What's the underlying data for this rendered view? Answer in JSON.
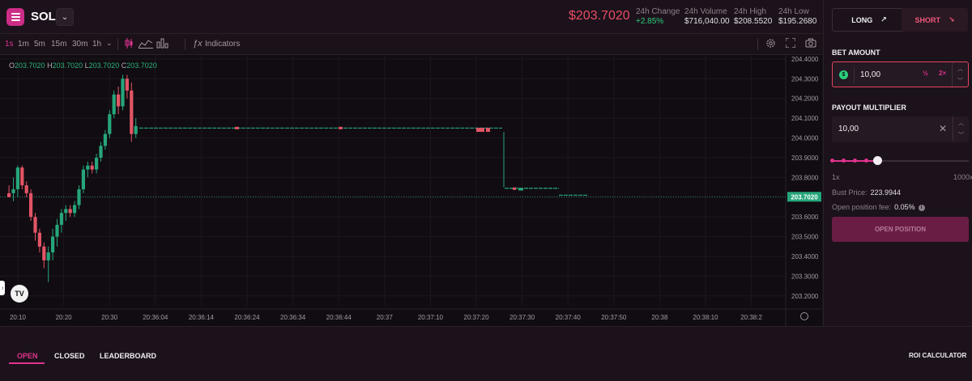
{
  "header": {
    "pair": "SOL",
    "price": "$203.7020",
    "stats": [
      {
        "label": "24h Change",
        "value": "+2.85%",
        "positive": true
      },
      {
        "label": "24h Volume",
        "value": "$716,040.00"
      },
      {
        "label": "24h High",
        "value": "$208.5520"
      },
      {
        "label": "24h Low",
        "value": "$195.2680"
      }
    ]
  },
  "toolbar": {
    "timeframes": [
      "1s",
      "1m",
      "5m",
      "15m",
      "30m",
      "1h"
    ],
    "active_timeframe": "1s",
    "indicators_label": "Indicators"
  },
  "ohlc": {
    "o_label": "O",
    "o": "203.7020",
    "h_label": "H",
    "h": "203.7020",
    "l_label": "L",
    "l": "203.7020",
    "c_label": "C",
    "c": "203.7020"
  },
  "tv_label": "TV",
  "chart_data": {
    "type": "candlestick",
    "ylim": [
      203.15,
      204.42
    ],
    "y_ticks": [
      "204.4000",
      "204.3000",
      "204.2000",
      "204.1000",
      "204.0000",
      "203.9000",
      "203.8000",
      "203.7000",
      "203.6000",
      "203.5000",
      "203.4000",
      "203.3000",
      "203.2000"
    ],
    "x_ticks": [
      "20:10",
      "20:20",
      "20:30",
      "20:36:04",
      "20:36:14",
      "20:36:24",
      "20:36:34",
      "20:36:44",
      "20:37",
      "20:37:10",
      "20:37:20",
      "20:37:30",
      "20:37:40",
      "20:37:50",
      "20:38",
      "20:38:10",
      "20:38:2"
    ],
    "current_price": "203.7020",
    "current_price_value": 203.702,
    "colors": {
      "up": "#26a67a",
      "down": "#e25565",
      "grid": "#1d171e",
      "price_tag": "#26a67a"
    },
    "candles": [
      {
        "o": 203.72,
        "h": 203.76,
        "l": 203.7,
        "c": 203.7
      },
      {
        "o": 203.72,
        "h": 203.8,
        "l": 203.68,
        "c": 203.74
      },
      {
        "o": 203.74,
        "h": 203.86,
        "l": 203.7,
        "c": 203.85
      },
      {
        "o": 203.85,
        "h": 203.86,
        "l": 203.74,
        "c": 203.76
      },
      {
        "o": 203.76,
        "h": 203.78,
        "l": 203.7,
        "c": 203.72
      },
      {
        "o": 203.72,
        "h": 203.74,
        "l": 203.58,
        "c": 203.6
      },
      {
        "o": 203.6,
        "h": 203.62,
        "l": 203.48,
        "c": 203.52
      },
      {
        "o": 203.52,
        "h": 203.54,
        "l": 203.42,
        "c": 203.45
      },
      {
        "o": 203.45,
        "h": 203.47,
        "l": 203.34,
        "c": 203.38
      },
      {
        "o": 203.38,
        "h": 203.45,
        "l": 203.27,
        "c": 203.42
      },
      {
        "o": 203.42,
        "h": 203.54,
        "l": 203.38,
        "c": 203.5
      },
      {
        "o": 203.5,
        "h": 203.59,
        "l": 203.45,
        "c": 203.56
      },
      {
        "o": 203.56,
        "h": 203.64,
        "l": 203.52,
        "c": 203.62
      },
      {
        "o": 203.62,
        "h": 203.66,
        "l": 203.58,
        "c": 203.64
      },
      {
        "o": 203.64,
        "h": 203.66,
        "l": 203.6,
        "c": 203.62
      },
      {
        "o": 203.62,
        "h": 203.68,
        "l": 203.6,
        "c": 203.66
      },
      {
        "o": 203.66,
        "h": 203.76,
        "l": 203.64,
        "c": 203.74
      },
      {
        "o": 203.74,
        "h": 203.86,
        "l": 203.72,
        "c": 203.84
      },
      {
        "o": 203.84,
        "h": 203.88,
        "l": 203.8,
        "c": 203.86
      },
      {
        "o": 203.86,
        "h": 203.88,
        "l": 203.82,
        "c": 203.84
      },
      {
        "o": 203.84,
        "h": 203.92,
        "l": 203.82,
        "c": 203.9
      },
      {
        "o": 203.9,
        "h": 203.98,
        "l": 203.88,
        "c": 203.96
      },
      {
        "o": 203.96,
        "h": 204.04,
        "l": 203.94,
        "c": 204.02
      },
      {
        "o": 204.02,
        "h": 204.14,
        "l": 204.0,
        "c": 204.12
      },
      {
        "o": 204.12,
        "h": 204.24,
        "l": 204.1,
        "c": 204.22
      },
      {
        "o": 204.22,
        "h": 204.26,
        "l": 204.12,
        "c": 204.16
      },
      {
        "o": 204.16,
        "h": 204.32,
        "l": 204.14,
        "c": 204.3
      },
      {
        "o": 204.3,
        "h": 204.32,
        "l": 204.2,
        "c": 204.24
      },
      {
        "o": 204.24,
        "h": 204.28,
        "l": 203.98,
        "c": 204.02
      },
      {
        "o": 204.02,
        "h": 204.1,
        "l": 204.0,
        "c": 204.06
      }
    ],
    "flat_segments": [
      {
        "from": "20:36:04",
        "to": "20:37:14",
        "value": 204.05
      },
      {
        "from": "20:37:18",
        "to": "20:37:30",
        "value": 203.745
      },
      {
        "from": "20:37:30",
        "to": "20:37:38",
        "value": 203.71
      }
    ]
  },
  "panel": {
    "long_label": "LONG",
    "short_label": "SHORT",
    "bet_title": "BET AMOUNT",
    "bet_value": "10,00",
    "pct_label": "½",
    "double_label": "2×",
    "mult_title": "PAYOUT MULTIPLIER",
    "mult_value": "10,00",
    "slider_min": "1x",
    "slider_max": "1000x",
    "slider_level": 0.33,
    "bust_label": "Bust Price:",
    "bust_value": "223.9944",
    "fee_label": "Open position fee:",
    "fee_value": "0.05%",
    "open_label": "OPEN POSITION"
  },
  "bottom": {
    "tabs": [
      "OPEN",
      "CLOSED",
      "LEADERBOARD"
    ],
    "active_tab": "OPEN",
    "roi_label": "ROI CALCULATOR"
  }
}
